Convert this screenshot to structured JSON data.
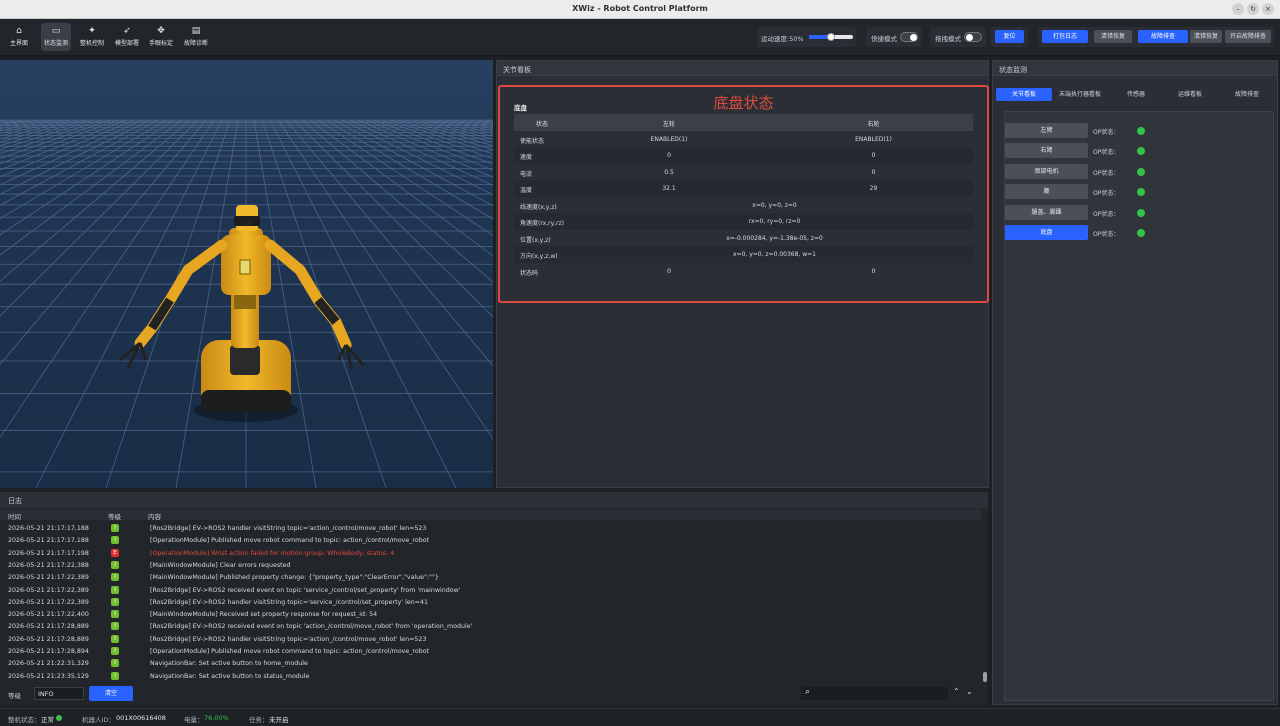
{
  "window": {
    "title": "XWiz - Robot Control Platform",
    "controls": [
      "–",
      "↻",
      "×"
    ]
  },
  "nav": {
    "items": [
      {
        "label": "主界面",
        "icon": "home-icon",
        "glyph": "⌂"
      },
      {
        "label": "状态监测",
        "icon": "monitor-icon",
        "glyph": "▭",
        "active": true
      },
      {
        "label": "整机控制",
        "icon": "wand-icon",
        "glyph": "✦"
      },
      {
        "label": "模型部署",
        "icon": "rocket-icon",
        "glyph": "➶"
      },
      {
        "label": "手眼标定",
        "icon": "eye-hand-icon",
        "glyph": "✥"
      },
      {
        "label": "故障诊断",
        "icon": "clipboard-icon",
        "glyph": "▤"
      }
    ]
  },
  "toolbar": {
    "speed_label": "运动速度:50%",
    "speed_value": 50,
    "fast_mode_label": "快捷模式",
    "drag_mode_label": "拖拽模式",
    "reset_label": "复位",
    "pack_log_label": "打包日志",
    "clear_error_label": "清错恢复",
    "fault_check_label": "故障排查",
    "clear_error2_label": "清错恢复",
    "start_fault_check_label": "开启故障排查"
  },
  "joint_panel": {
    "header": "关节看板",
    "title": "底盘状态",
    "table_name": "底盘",
    "columns": [
      "状态",
      "左轮",
      "右轮"
    ],
    "rows": [
      {
        "label": "使能状态",
        "left": "ENABLED(1)",
        "right": "ENABLED(1)"
      },
      {
        "label": "速度",
        "left": "0",
        "right": "0"
      },
      {
        "label": "电流",
        "left": "0.5",
        "right": "0"
      },
      {
        "label": "温度",
        "left": "32.1",
        "right": "29"
      },
      {
        "label": "线速度(x,y,z)",
        "span": "x=0, y=0, z=0"
      },
      {
        "label": "角速度(rx,ry,rz)",
        "span": "rx=0, ry=0, rz=0"
      },
      {
        "label": "位置(x,y,z)",
        "span": "x=-0.000284, y=-1.38e-05, z=0"
      },
      {
        "label": "方向(x,y,z,w)",
        "span": "x=0, y=0, z=0.00368, w=1"
      },
      {
        "label": "状态码",
        "left": "0",
        "right": "0"
      }
    ]
  },
  "status_panel": {
    "header": "状态监测",
    "tabs": [
      "关节看板",
      "末端执行器看板",
      "传感器",
      "运维看板",
      "故障排查"
    ],
    "active_tab": 0,
    "parts": [
      {
        "label": "左臂",
        "op": "OP状态：",
        "status_color": "#35c24a"
      },
      {
        "label": "右臂",
        "op": "OP状态：",
        "status_color": "#35c24a"
      },
      {
        "label": "颈部电机",
        "op": "OP状态：",
        "status_color": "#35c24a"
      },
      {
        "label": "腰",
        "op": "OP状态：",
        "status_color": "#35c24a"
      },
      {
        "label": "腿盖、脚踝",
        "op": "OP状态：",
        "status_color": "#35c24a"
      },
      {
        "label": "底盘",
        "op": "OP状态：",
        "status_color": "#35c24a",
        "active": true
      }
    ]
  },
  "log": {
    "header": "日志",
    "columns": [
      "时间",
      "等级",
      "内容"
    ],
    "rows": [
      {
        "time": "2026-05-21 21:17:17,188",
        "level": "I",
        "msg": "[Ros2Bridge] EV->ROS2 handler visitString topic='action_/control/move_robot' len=523"
      },
      {
        "time": "2026-05-21 21:17:17,188",
        "level": "I",
        "msg": "[OperationModule] Published move robot command to topic: action_/control/move_robot"
      },
      {
        "time": "2026-05-21 21:17:17,198",
        "level": "E",
        "msg": "[OperationModule] Wrist action failed for motion group: WholeBody, status: 4"
      },
      {
        "time": "2026-05-21 21:17:22,388",
        "level": "I",
        "msg": "[MainWindowModule] Clear errors requested"
      },
      {
        "time": "2026-05-21 21:17:22,389",
        "level": "I",
        "msg": "[MainWindowModule] Published property change: {\"property_type\":\"ClearError\",\"value\":\"\"}"
      },
      {
        "time": "2026-05-21 21:17:22,389",
        "level": "I",
        "msg": "[Ros2Bridge] EV->ROS2 received event on topic 'service_/control/set_property' from 'mainwindow'"
      },
      {
        "time": "2026-05-21 21:17:22,389",
        "level": "I",
        "msg": "[Ros2Bridge] EV->ROS2 handler visitString topic='service_/control/set_property' len=41"
      },
      {
        "time": "2026-05-21 21:17:22,400",
        "level": "I",
        "msg": "[MainWindowModule] Received set property response for request_id: 54"
      },
      {
        "time": "2026-05-21 21:17:28,889",
        "level": "I",
        "msg": "[Ros2Bridge] EV->ROS2 received event on topic 'action_/control/move_robot' from 'operation_module'"
      },
      {
        "time": "2026-05-21 21:17:28,889",
        "level": "I",
        "msg": "[Ros2Bridge] EV->ROS2 handler visitString topic='action_/control/move_robot' len=523"
      },
      {
        "time": "2026-05-21 21:17:28,894",
        "level": "I",
        "msg": "[OperationModule] Published move robot command to topic: action_/control/move_robot"
      },
      {
        "time": "2026-05-21 21:22:31,329",
        "level": "I",
        "msg": "NavigationBar: Set active button to home_module"
      },
      {
        "time": "2026-05-21 21:23:35,129",
        "level": "I",
        "msg": "NavigationBar: Set active button to status_module"
      }
    ],
    "level_label": "等级",
    "level_value": "INFO",
    "clear_label": "清空",
    "search_placeholder": ""
  },
  "status_bar": {
    "machine_state_label": "整机状态：",
    "machine_state": "正常",
    "robot_id_label": "机器人ID：",
    "robot_id": "001X00616408",
    "battery_label": "电量：",
    "battery": "76.00%",
    "task_label": "任务：",
    "task": "未开启"
  }
}
